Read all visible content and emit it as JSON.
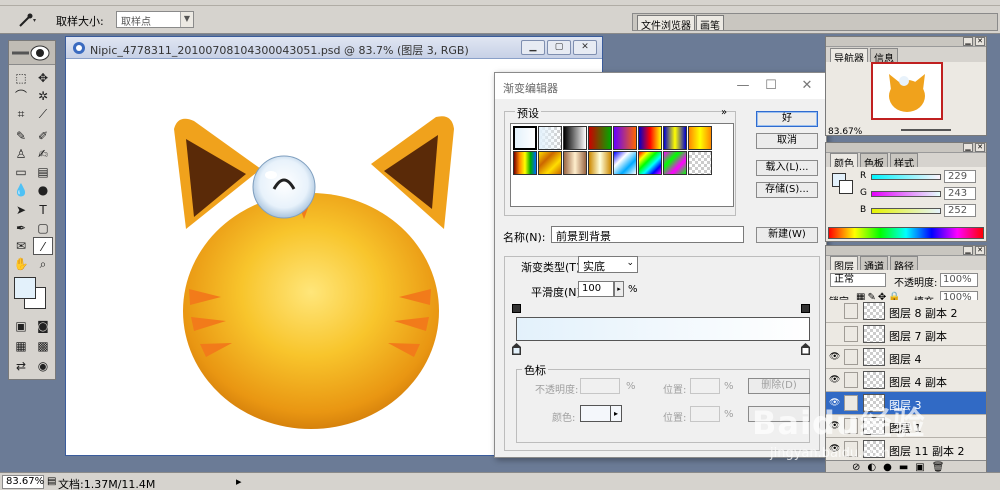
{
  "options_bar": {
    "sample_size_label": "取样大小:",
    "sample_size_value": "取样点",
    "palette_tabs": [
      "文件浏览器",
      "画笔"
    ]
  },
  "document": {
    "title": "Nipic_4778311_20100708104300043051.psd @ 83.7% (图层 3, RGB)",
    "fg_color": "#e3f1fb",
    "bg_color": "#ffffff"
  },
  "status_bar": {
    "zoom": "83.67%",
    "doc_size": "文档:1.37M/11.4M"
  },
  "gradient_editor": {
    "title": "渐变编辑器",
    "presets_label": "预设",
    "presets_menu": "»",
    "buttons": {
      "ok": "好",
      "cancel": "取消",
      "load": "载入(L)...",
      "save": "存储(S)...",
      "new": "新建(W)"
    },
    "name_label": "名称(N):",
    "name_value": "前景到背景",
    "gradient_type_label": "渐变类型(T):",
    "gradient_type_value": "实底",
    "smoothness_label": "平滑度(N):",
    "smoothness_value": "100",
    "smoothness_unit": "%",
    "stops_group_label": "色标",
    "opacity_label": "不透明度:",
    "location_label": "位置:",
    "color_label": "颜色:",
    "delete_label": "删除(D)",
    "percent": "%",
    "start_color": "#e3f1fb",
    "end_color": "#ffffff"
  },
  "navigator": {
    "tabs": [
      "导航器",
      "信息"
    ],
    "zoom": "83.67%"
  },
  "color_panel": {
    "tabs": [
      "颜色",
      "色板",
      "样式"
    ],
    "channels": [
      {
        "label": "R",
        "value": "229"
      },
      {
        "label": "G",
        "value": "243"
      },
      {
        "label": "B",
        "value": "252"
      }
    ]
  },
  "layers_panel": {
    "tabs": [
      "图层",
      "通道",
      "路径"
    ],
    "blend_mode": "正常",
    "opacity_label": "不透明度:",
    "opacity_value": "100%",
    "lock_label": "锁定:",
    "fill_label": "填充:",
    "fill_value": "100%",
    "layers": [
      {
        "name": "图层 8 副本 2",
        "visible": false,
        "selected": false
      },
      {
        "name": "图层 7 副本",
        "visible": false,
        "selected": false
      },
      {
        "name": "图层 4",
        "visible": true,
        "selected": false
      },
      {
        "name": "图层 4 副本",
        "visible": true,
        "selected": false
      },
      {
        "name": "图层 3",
        "visible": true,
        "selected": true
      },
      {
        "name": "图层 1",
        "visible": true,
        "selected": false
      },
      {
        "name": "图层 11 副本 2",
        "visible": true,
        "selected": false
      }
    ]
  },
  "watermark": {
    "text": "Baidu经验",
    "sub": "jingyan.baidu.com"
  }
}
